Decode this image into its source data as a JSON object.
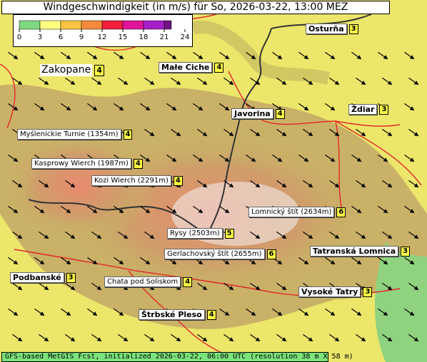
{
  "title": "Windgeschwindigkeit (in m/s) für So, 2026-03-22, 13:00 MEZ",
  "footer": "GFS-based MetGIS Fcst, initialized 2026-03-22, 06:00 UTC  (resolution 38 m X 58 m)",
  "legend": {
    "ticks": [
      "0",
      "3",
      "6",
      "9",
      "12",
      "15",
      "18",
      "21",
      "24"
    ],
    "colors": [
      "#7fd77f",
      "#ffff80",
      "#f7c542",
      "#f78a3c",
      "#f01e3c",
      "#e0149b",
      "#a61ec8",
      "#6e1480"
    ]
  },
  "wind_arrows": {
    "count_rows": 12,
    "count_cols": 16,
    "direction": "northwest-to-southeast",
    "color": "#000000"
  },
  "labels": [
    {
      "name": "Osturňa",
      "value": "3",
      "style": "bold"
    },
    {
      "name": "Zakopane",
      "value": "4",
      "style": "big"
    },
    {
      "name": "Małe Ciche",
      "value": "4",
      "style": "bold"
    },
    {
      "name": "Javorina",
      "value": "4",
      "style": "bold"
    },
    {
      "name": "Ždiar",
      "value": "3",
      "style": "bold"
    },
    {
      "name": "Myślenickie Turnie (1354m)",
      "value": "4",
      "style": "normal"
    },
    {
      "name": "Kasprowy Wierch (1987m)",
      "value": "4",
      "style": "normal"
    },
    {
      "name": "Kozi Wierch (2291m)",
      "value": "4",
      "style": "normal"
    },
    {
      "name": "Lomnický štít (2634m)",
      "value": "6",
      "style": "normal"
    },
    {
      "name": "Rysy (2503m)",
      "value": "5",
      "style": "normal"
    },
    {
      "name": "Gerlachovský štít (2655m)",
      "value": "6",
      "style": "normal"
    },
    {
      "name": "Tatranská Lomnica",
      "value": "3",
      "style": "bold"
    },
    {
      "name": "Podbanské",
      "value": "3",
      "style": "bold"
    },
    {
      "name": "Chata pod Soliskom",
      "value": "4",
      "style": "normal"
    },
    {
      "name": "Vysoké Tatry",
      "value": "3",
      "style": "bold"
    },
    {
      "name": "Štrbské Pleso",
      "value": "4",
      "style": "bold"
    }
  ]
}
